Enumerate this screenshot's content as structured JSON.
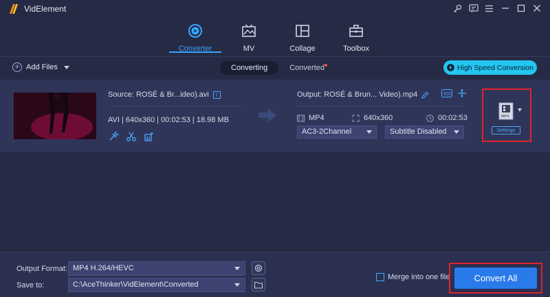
{
  "app": {
    "title": "VidElement"
  },
  "window_controls": [
    "key-icon",
    "feedback-icon",
    "menu-icon",
    "minimize-icon",
    "maximize-icon",
    "close-icon"
  ],
  "nav": {
    "tabs": [
      {
        "label": "Converter",
        "icon": "converter-icon",
        "active": true
      },
      {
        "label": "MV",
        "icon": "mv-icon",
        "active": false
      },
      {
        "label": "Collage",
        "icon": "collage-icon",
        "active": false
      },
      {
        "label": "Toolbox",
        "icon": "toolbox-icon",
        "active": false
      }
    ]
  },
  "toolbar": {
    "add_files_label": "Add Files",
    "tabs": [
      {
        "label": "Converting",
        "active": true
      },
      {
        "label": "Converted",
        "active": false,
        "has_notification": true
      }
    ],
    "high_speed_label": "High Speed Conversion"
  },
  "file": {
    "source_name": "Source: ROSÉ & Br...ideo).avi",
    "source_meta": "AVI | 640x360 | 00:02:53 | 18.98 MB",
    "output_name": "Output: ROSÉ & Brun... Video).mp4",
    "output_format": "MP4",
    "output_resolution": "640x360",
    "output_duration": "00:02:53",
    "audio_track": "AC3-2Channel",
    "subtitle": "Subtitle Disabled",
    "format_icon_label": "MP4",
    "settings_label": "Settings"
  },
  "bottom": {
    "output_format_label": "Output Format:",
    "output_format_value": "MP4 H.264/HEVC",
    "save_to_label": "Save to:",
    "save_to_value": "C:\\AceThinker\\VidElement\\Converted",
    "merge_label": "Merge into one file",
    "convert_all_label": "Convert All"
  },
  "colors": {
    "accent": "#3aa5ff",
    "highlight": "#e0232a",
    "primary_button": "#2a7bea",
    "high_speed": "#23c6f0"
  }
}
